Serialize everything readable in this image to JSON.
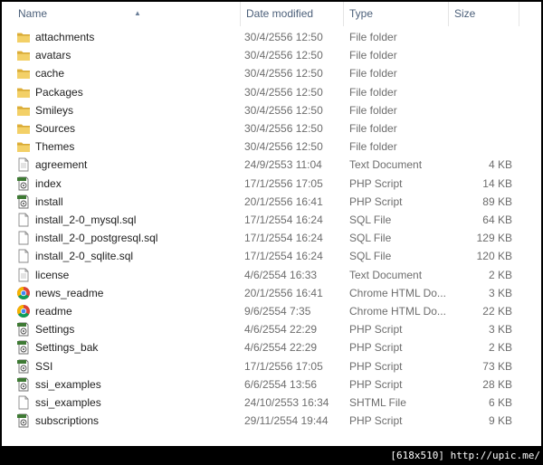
{
  "columns": {
    "name": "Name",
    "date": "Date modified",
    "type": "Type",
    "size": "Size"
  },
  "files": [
    {
      "name": "attachments",
      "date": "30/4/2556 12:50",
      "type": "File folder",
      "size": "",
      "icon": "folder-icon"
    },
    {
      "name": "avatars",
      "date": "30/4/2556 12:50",
      "type": "File folder",
      "size": "",
      "icon": "folder-icon"
    },
    {
      "name": "cache",
      "date": "30/4/2556 12:50",
      "type": "File folder",
      "size": "",
      "icon": "folder-icon"
    },
    {
      "name": "Packages",
      "date": "30/4/2556 12:50",
      "type": "File folder",
      "size": "",
      "icon": "folder-icon"
    },
    {
      "name": "Smileys",
      "date": "30/4/2556 12:50",
      "type": "File folder",
      "size": "",
      "icon": "folder-icon"
    },
    {
      "name": "Sources",
      "date": "30/4/2556 12:50",
      "type": "File folder",
      "size": "",
      "icon": "folder-icon"
    },
    {
      "name": "Themes",
      "date": "30/4/2556 12:50",
      "type": "File folder",
      "size": "",
      "icon": "folder-icon"
    },
    {
      "name": "agreement",
      "date": "24/9/2553 11:04",
      "type": "Text Document",
      "size": "4 KB",
      "icon": "text-document-icon"
    },
    {
      "name": "index",
      "date": "17/1/2556 17:05",
      "type": "PHP Script",
      "size": "14 KB",
      "icon": "php-script-icon"
    },
    {
      "name": "install",
      "date": "20/1/2556 16:41",
      "type": "PHP Script",
      "size": "89 KB",
      "icon": "php-script-icon"
    },
    {
      "name": "install_2-0_mysql.sql",
      "date": "17/1/2554 16:24",
      "type": "SQL File",
      "size": "64 KB",
      "icon": "sql-file-icon"
    },
    {
      "name": "install_2-0_postgresql.sql",
      "date": "17/1/2554 16:24",
      "type": "SQL File",
      "size": "129 KB",
      "icon": "sql-file-icon"
    },
    {
      "name": "install_2-0_sqlite.sql",
      "date": "17/1/2554 16:24",
      "type": "SQL File",
      "size": "120 KB",
      "icon": "sql-file-icon"
    },
    {
      "name": "license",
      "date": "4/6/2554 16:33",
      "type": "Text Document",
      "size": "2 KB",
      "icon": "text-document-icon"
    },
    {
      "name": "news_readme",
      "date": "20/1/2556 16:41",
      "type": "Chrome HTML Do...",
      "size": "3 KB",
      "icon": "chrome-icon"
    },
    {
      "name": "readme",
      "date": "9/6/2554 7:35",
      "type": "Chrome HTML Do...",
      "size": "22 KB",
      "icon": "chrome-icon"
    },
    {
      "name": "Settings",
      "date": "4/6/2554 22:29",
      "type": "PHP Script",
      "size": "3 KB",
      "icon": "php-script-icon"
    },
    {
      "name": "Settings_bak",
      "date": "4/6/2554 22:29",
      "type": "PHP Script",
      "size": "2 KB",
      "icon": "php-script-icon"
    },
    {
      "name": "SSI",
      "date": "17/1/2556 17:05",
      "type": "PHP Script",
      "size": "73 KB",
      "icon": "php-script-icon"
    },
    {
      "name": "ssi_examples",
      "date": "6/6/2554 13:56",
      "type": "PHP Script",
      "size": "28 KB",
      "icon": "php-script-icon"
    },
    {
      "name": "ssi_examples",
      "date": "24/10/2553 16:34",
      "type": "SHTML File",
      "size": "6 KB",
      "icon": "shtml-file-icon"
    },
    {
      "name": "subscriptions",
      "date": "29/11/2554 19:44",
      "type": "PHP Script",
      "size": "9 KB",
      "icon": "php-script-icon"
    }
  ],
  "footer": {
    "text": "[618x510] http://upic.me/"
  },
  "colors": {
    "header_text": "#4c607a",
    "folder": "#e8bf4a",
    "php_green": "#4b7a3a"
  }
}
